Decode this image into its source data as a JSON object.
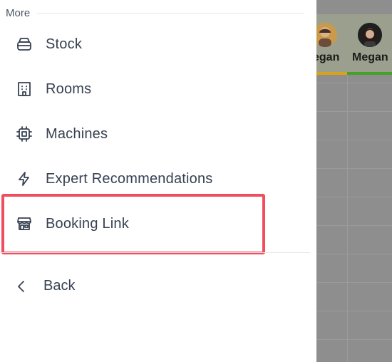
{
  "menu": {
    "section_title": "More",
    "items": [
      {
        "label": "Stock",
        "icon": "box-icon"
      },
      {
        "label": "Rooms",
        "icon": "building-icon"
      },
      {
        "label": "Machines",
        "icon": "cpu-icon"
      },
      {
        "label": "Expert Recommendations",
        "icon": "lightning-icon"
      },
      {
        "label": "Booking Link",
        "icon": "storefront-icon",
        "highlighted": true
      }
    ],
    "back_label": "Back"
  },
  "background": {
    "staff": [
      {
        "name_visible": "egan",
        "accent": "#d9a21b"
      },
      {
        "name_visible": "Megan",
        "accent": "#46a12b"
      }
    ]
  },
  "colors": {
    "text": "#374151",
    "highlight": "#f04e5e",
    "overlay": "#8e8e8e"
  }
}
